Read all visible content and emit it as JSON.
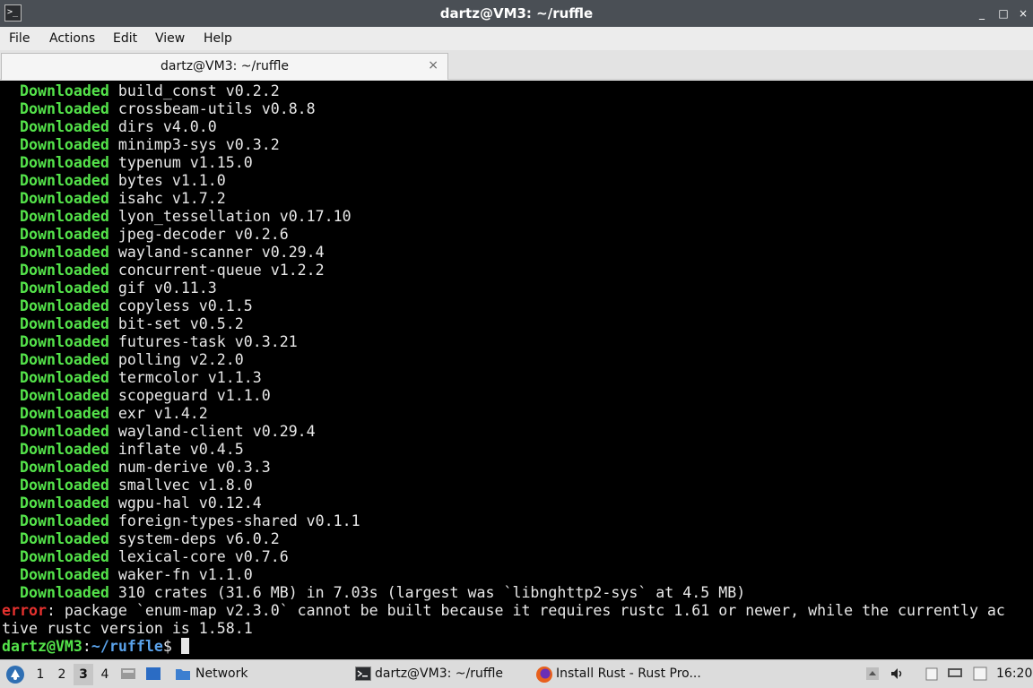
{
  "window": {
    "title": "dartz@VM3: ~/ruffle",
    "controls": [
      "_",
      "□",
      "×"
    ]
  },
  "menu": [
    "File",
    "Actions",
    "Edit",
    "View",
    "Help"
  ],
  "tab": {
    "label": "dartz@VM3: ~/ruffle",
    "close": "×"
  },
  "terminal": {
    "downloaded": [
      "build_const v0.2.2",
      "crossbeam-utils v0.8.8",
      "dirs v4.0.0",
      "minimp3-sys v0.3.2",
      "typenum v1.15.0",
      "bytes v1.1.0",
      "isahc v1.7.2",
      "lyon_tessellation v0.17.10",
      "jpeg-decoder v0.2.6",
      "wayland-scanner v0.29.4",
      "concurrent-queue v1.2.2",
      "gif v0.11.3",
      "copyless v0.1.5",
      "bit-set v0.5.2",
      "futures-task v0.3.21",
      "polling v2.2.0",
      "termcolor v1.1.3",
      "scopeguard v1.1.0",
      "exr v1.4.2",
      "wayland-client v0.29.4",
      "inflate v0.4.5",
      "num-derive v0.3.3",
      "smallvec v1.8.0",
      "wgpu-hal v0.12.4",
      "foreign-types-shared v0.1.1",
      "system-deps v6.0.2",
      "lexical-core v0.7.6",
      "waker-fn v1.1.0",
      "310 crates (31.6 MB) in 7.03s (largest was `libnghttp2-sys` at 4.5 MB)"
    ],
    "keyword": "Downloaded",
    "error_label": "error",
    "error_line1": ": package `enum-map v2.3.0` cannot be built because it requires rustc 1.61 or newer, while the currently ac",
    "error_line2": "tive rustc version is 1.58.1",
    "prompt_user": "dartz@VM3",
    "prompt_sep": ":",
    "prompt_path": "~/ruffle",
    "prompt_symbol": "$ "
  },
  "taskbar": {
    "workspaces": [
      "1",
      "2",
      "3",
      "4"
    ],
    "active_workspace": "3",
    "file_manager": "Network",
    "tasks": [
      "dartz@VM3: ~/ruffle",
      "Install Rust - Rust Pro..."
    ],
    "clock": "16:20"
  }
}
